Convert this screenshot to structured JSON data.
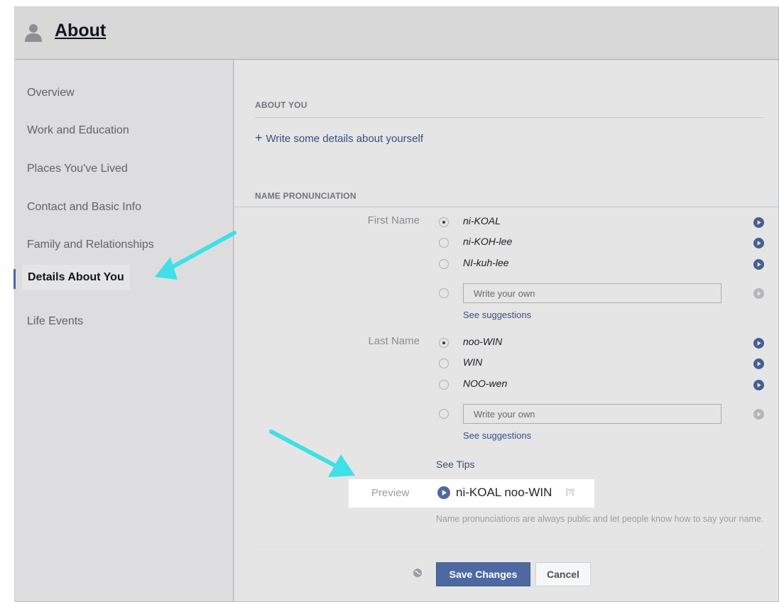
{
  "header": {
    "title": "About",
    "icon": "person-icon"
  },
  "sidebar": {
    "items": [
      {
        "label": "Overview"
      },
      {
        "label": "Work and Education"
      },
      {
        "label": "Places You've Lived"
      },
      {
        "label": "Contact and Basic Info"
      },
      {
        "label": "Family and Relationships"
      },
      {
        "label": "Details About You"
      },
      {
        "label": "Life Events"
      }
    ],
    "active_label": "Details About You"
  },
  "about_you": {
    "heading": "ABOUT YOU",
    "add_link": "Write some details about yourself"
  },
  "pronunciation": {
    "heading": "NAME PRONUNCIATION",
    "first_name": {
      "label": "First Name",
      "options": [
        "ni-KOAL",
        "ni-KOH-lee",
        "NI-kuh-lee"
      ],
      "selected": "ni-KOAL",
      "own_placeholder": "Write your own",
      "suggestions_link": "See suggestions"
    },
    "last_name": {
      "label": "Last Name",
      "options": [
        "noo-WIN",
        "WIN",
        "NOO-wen"
      ],
      "selected": "noo-WIN",
      "own_placeholder": "Write your own",
      "suggestions_link": "See suggestions"
    },
    "tips_link": "See Tips",
    "preview": {
      "label": "Preview",
      "text": "ni-KOAL noo-WIN",
      "help": "[?]"
    },
    "note": "Name pronunciations are always public and let people know how to say your name."
  },
  "actions": {
    "save_label": "Save Changes",
    "cancel_label": "Cancel"
  },
  "colors": {
    "accent": "#4e69a2",
    "link": "#3b5998",
    "highlight_arrow": "#3fe0e8"
  }
}
